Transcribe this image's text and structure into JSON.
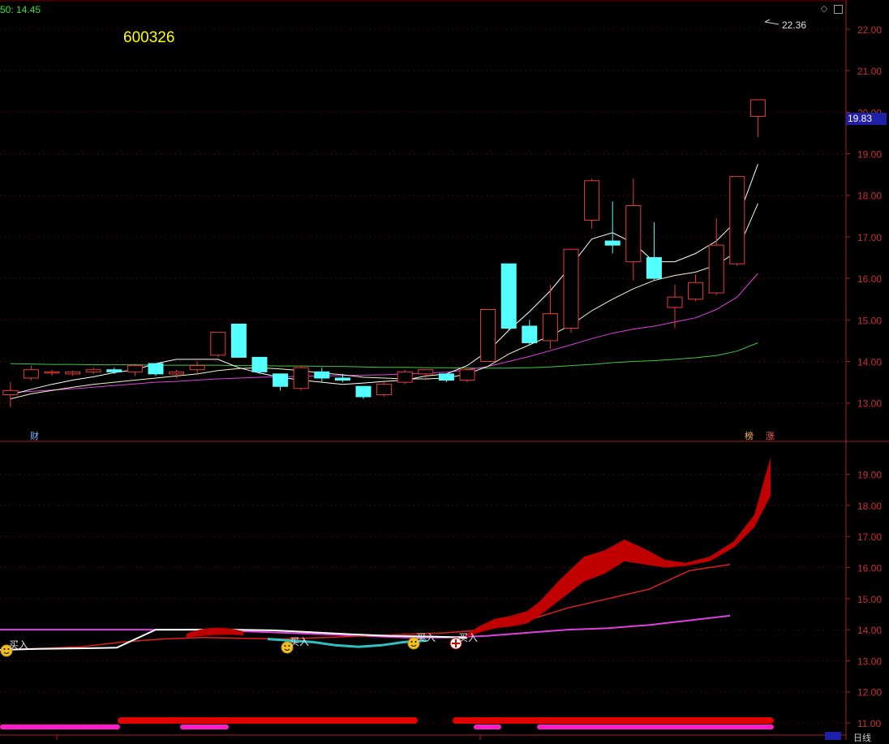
{
  "header": {
    "ma_label": "50: 14.45",
    "symbol": "600326",
    "high_marker": "22.36",
    "current_price": "19.83"
  },
  "markers": {
    "finance": "财",
    "rank": "榜",
    "rise": "涨",
    "bottom_view": "日线"
  },
  "signals": [
    {
      "label": "买入",
      "icon": "smiley-icon"
    },
    {
      "label": "买入",
      "icon": "smiley-icon"
    },
    {
      "label": "买入",
      "icon": "smiley-icon"
    },
    {
      "label": "买入",
      "icon": "crosshair-icon"
    }
  ],
  "colors": {
    "up": "#e83c3c",
    "down": "#54ffff",
    "grid": "#8b0000",
    "axis": "#b01c1c",
    "ma5": "#ffffff",
    "ma10": "#f5f5c8",
    "ma20": "#e040e0",
    "ma50": "#3ec83e",
    "accent": "#ffff00"
  },
  "chart_data": [
    {
      "type": "candlestick",
      "title": "600326",
      "ylim": [
        12.6,
        22.6
      ],
      "y_ticks": [
        "13.00",
        "14.00",
        "15.00",
        "16.00",
        "17.00",
        "18.00",
        "19.00",
        "20.00",
        "21.00",
        "22.00"
      ],
      "candles": [
        {
          "o": 13.2,
          "h": 13.5,
          "l": 12.9,
          "c": 13.3
        },
        {
          "o": 13.6,
          "h": 13.9,
          "l": 13.55,
          "c": 13.8
        },
        {
          "o": 13.72,
          "h": 13.8,
          "l": 13.65,
          "c": 13.75
        },
        {
          "o": 13.7,
          "h": 13.78,
          "l": 13.65,
          "c": 13.75
        },
        {
          "o": 13.75,
          "h": 13.85,
          "l": 13.7,
          "c": 13.8
        },
        {
          "o": 13.8,
          "h": 13.85,
          "l": 13.7,
          "c": 13.75
        },
        {
          "o": 13.75,
          "h": 13.95,
          "l": 13.65,
          "c": 13.9
        },
        {
          "o": 13.95,
          "h": 13.95,
          "l": 13.65,
          "c": 13.7
        },
        {
          "o": 13.7,
          "h": 13.8,
          "l": 13.6,
          "c": 13.75
        },
        {
          "o": 13.8,
          "h": 14.0,
          "l": 13.7,
          "c": 13.9
        },
        {
          "o": 14.15,
          "h": 14.7,
          "l": 14.1,
          "c": 14.7
        },
        {
          "o": 14.9,
          "h": 14.9,
          "l": 14.1,
          "c": 14.1
        },
        {
          "o": 14.1,
          "h": 14.1,
          "l": 13.7,
          "c": 13.75
        },
        {
          "o": 13.7,
          "h": 13.7,
          "l": 13.3,
          "c": 13.4
        },
        {
          "o": 13.35,
          "h": 13.9,
          "l": 13.3,
          "c": 13.85
        },
        {
          "o": 13.75,
          "h": 13.85,
          "l": 13.5,
          "c": 13.6
        },
        {
          "o": 13.6,
          "h": 13.7,
          "l": 13.5,
          "c": 13.55
        },
        {
          "o": 13.4,
          "h": 13.4,
          "l": 13.1,
          "c": 13.15
        },
        {
          "o": 13.2,
          "h": 13.5,
          "l": 13.15,
          "c": 13.45
        },
        {
          "o": 13.5,
          "h": 13.8,
          "l": 13.45,
          "c": 13.75
        },
        {
          "o": 13.7,
          "h": 13.8,
          "l": 13.55,
          "c": 13.8
        },
        {
          "o": 13.7,
          "h": 13.7,
          "l": 13.5,
          "c": 13.55
        },
        {
          "o": 13.55,
          "h": 13.85,
          "l": 13.5,
          "c": 13.8
        },
        {
          "o": 14.0,
          "h": 15.25,
          "l": 14.0,
          "c": 15.25
        },
        {
          "o": 16.35,
          "h": 16.35,
          "l": 14.75,
          "c": 14.8
        },
        {
          "o": 14.85,
          "h": 15.0,
          "l": 14.4,
          "c": 14.45
        },
        {
          "o": 14.5,
          "h": 15.85,
          "l": 14.3,
          "c": 15.15
        },
        {
          "o": 14.8,
          "h": 16.7,
          "l": 14.7,
          "c": 16.7
        },
        {
          "o": 17.4,
          "h": 18.4,
          "l": 17.2,
          "c": 18.35
        },
        {
          "o": 16.9,
          "h": 17.85,
          "l": 16.6,
          "c": 16.8
        },
        {
          "o": 16.4,
          "h": 18.4,
          "l": 15.95,
          "c": 17.75
        },
        {
          "o": 16.5,
          "h": 17.35,
          "l": 15.95,
          "c": 16.0
        },
        {
          "o": 15.3,
          "h": 15.85,
          "l": 14.8,
          "c": 15.55
        },
        {
          "o": 15.5,
          "h": 16.1,
          "l": 15.45,
          "c": 15.9
        },
        {
          "o": 15.65,
          "h": 17.45,
          "l": 15.6,
          "c": 16.8
        },
        {
          "o": 16.35,
          "h": 18.45,
          "l": 16.3,
          "c": 18.45
        },
        {
          "o": 19.9,
          "h": 20.3,
          "l": 19.4,
          "c": 20.3
        }
      ],
      "ma5": [
        13.2,
        13.33,
        13.45,
        13.55,
        13.63,
        13.73,
        13.8,
        13.95,
        14.05,
        14.05,
        14.05,
        13.85,
        13.72,
        13.62,
        13.55,
        13.5,
        13.45,
        13.48,
        13.52,
        13.55,
        13.65,
        13.7,
        13.9,
        14.25,
        14.75,
        15.2,
        15.7,
        16.3,
        16.95,
        17.1,
        16.85,
        16.4,
        16.4,
        16.6,
        16.9,
        17.4,
        18.75
      ],
      "ma10": [
        13.1,
        13.22,
        13.3,
        13.38,
        13.45,
        13.5,
        13.55,
        13.6,
        13.65,
        13.7,
        13.78,
        13.83,
        13.85,
        13.82,
        13.78,
        13.72,
        13.68,
        13.62,
        13.6,
        13.58,
        13.58,
        13.6,
        13.7,
        13.88,
        14.18,
        14.4,
        14.62,
        14.88,
        15.22,
        15.5,
        15.75,
        15.95,
        16.07,
        16.15,
        16.32,
        16.65,
        17.8
      ],
      "ma20": [
        13.25,
        13.28,
        13.31,
        13.34,
        13.38,
        13.42,
        13.46,
        13.5,
        13.52,
        13.55,
        13.58,
        13.6,
        13.62,
        13.63,
        13.64,
        13.65,
        13.66,
        13.67,
        13.68,
        13.7,
        13.72,
        13.74,
        13.8,
        13.88,
        14.0,
        14.12,
        14.26,
        14.4,
        14.55,
        14.68,
        14.78,
        14.85,
        14.95,
        15.05,
        15.25,
        15.55,
        16.12
      ],
      "ma50": [
        13.95,
        13.94,
        13.93,
        13.93,
        13.92,
        13.92,
        13.92,
        13.91,
        13.91,
        13.91,
        13.91,
        13.9,
        13.9,
        13.89,
        13.89,
        13.88,
        13.88,
        13.87,
        13.86,
        13.86,
        13.85,
        13.85,
        13.84,
        13.84,
        13.84,
        13.85,
        13.87,
        13.9,
        13.93,
        13.97,
        14.0,
        14.02,
        14.05,
        14.09,
        14.14,
        14.25,
        14.45
      ]
    },
    {
      "type": "area",
      "ylim": [
        10.9,
        19.8
      ],
      "y_ticks": [
        "11.00",
        "12.00",
        "13.00",
        "14.00",
        "15.00",
        "16.00",
        "17.00",
        "18.00",
        "19.00"
      ],
      "band_x": [
        575,
        590,
        610,
        630,
        650,
        665,
        690,
        720,
        745,
        770,
        795,
        820,
        845,
        875,
        905,
        930,
        950
      ],
      "band_upper": [
        13.85,
        14.1,
        14.35,
        14.45,
        14.6,
        14.9,
        15.6,
        16.35,
        16.55,
        16.9,
        16.6,
        16.25,
        16.15,
        16.35,
        16.85,
        17.7,
        19.55
      ],
      "band_lower": [
        13.75,
        13.9,
        14.05,
        14.1,
        14.2,
        14.45,
        14.95,
        15.55,
        15.8,
        16.2,
        16.1,
        16.0,
        16.05,
        16.2,
        16.65,
        17.3,
        18.3
      ],
      "red_line": [
        13.35,
        13.4,
        13.45,
        13.6,
        13.7,
        13.75,
        13.72,
        13.7,
        13.75,
        13.8,
        13.85,
        13.9,
        14.0,
        14.3,
        14.7,
        15.0,
        15.3,
        15.9,
        16.1
      ],
      "magenta_line": [
        14.0,
        14.0,
        14.0,
        14.0,
        14.0,
        14.0,
        13.95,
        13.9,
        13.85,
        13.8,
        13.75,
        13.75,
        13.8,
        13.9,
        14.0,
        14.05,
        14.15,
        14.3,
        14.45
      ],
      "white_line": [
        13.35,
        13.38,
        13.4,
        13.42,
        14.0,
        14.0,
        14.0,
        13.98,
        13.92,
        13.85,
        13.8,
        13.78,
        13.75
      ],
      "cyan_line": [
        13.7,
        13.65,
        13.6,
        13.5,
        13.45,
        13.5,
        13.6,
        13.65
      ],
      "legend": [],
      "grid": true
    }
  ]
}
